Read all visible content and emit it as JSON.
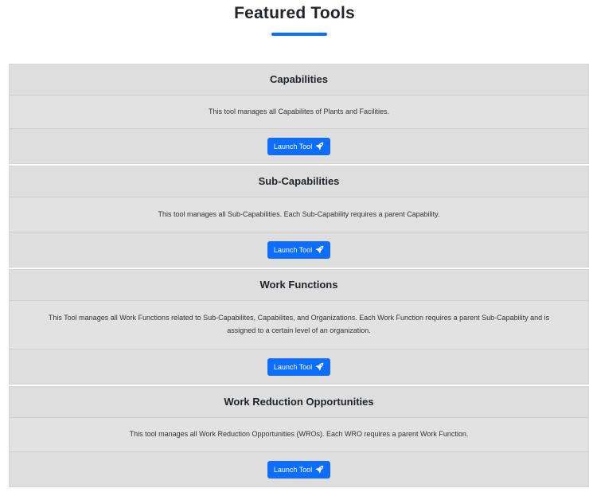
{
  "header": {
    "title": "Featured Tools",
    "accent_color": "#0d6efd"
  },
  "cards": [
    {
      "title": "Capabilities",
      "description": "This tool manages all Capabilites of Plants and Facilities.",
      "button_label": "Launch Tool",
      "button_icon": "rocket-icon"
    },
    {
      "title": "Sub-Capabilities",
      "description": "This tool manages all Sub-Capabilities. Each Sub-Capability requires a parent Capability.",
      "button_label": "Launch Tool",
      "button_icon": "rocket-icon"
    },
    {
      "title": "Work Functions",
      "description": "This Tool manages all Work Functions related to Sub-Capabilites, Capabilites, and Organizations. Each Work Function requires a parent Sub-Capability and is assigned to a certain level of an organization.",
      "button_label": "Launch Tool",
      "button_icon": "rocket-icon"
    },
    {
      "title": "Work Reduction Opportunities",
      "description": "This tool manages all Work Reduction Opportunities (WROs). Each WRO requires a parent Work Function.",
      "button_label": "Launch Tool",
      "button_icon": "rocket-icon"
    }
  ]
}
